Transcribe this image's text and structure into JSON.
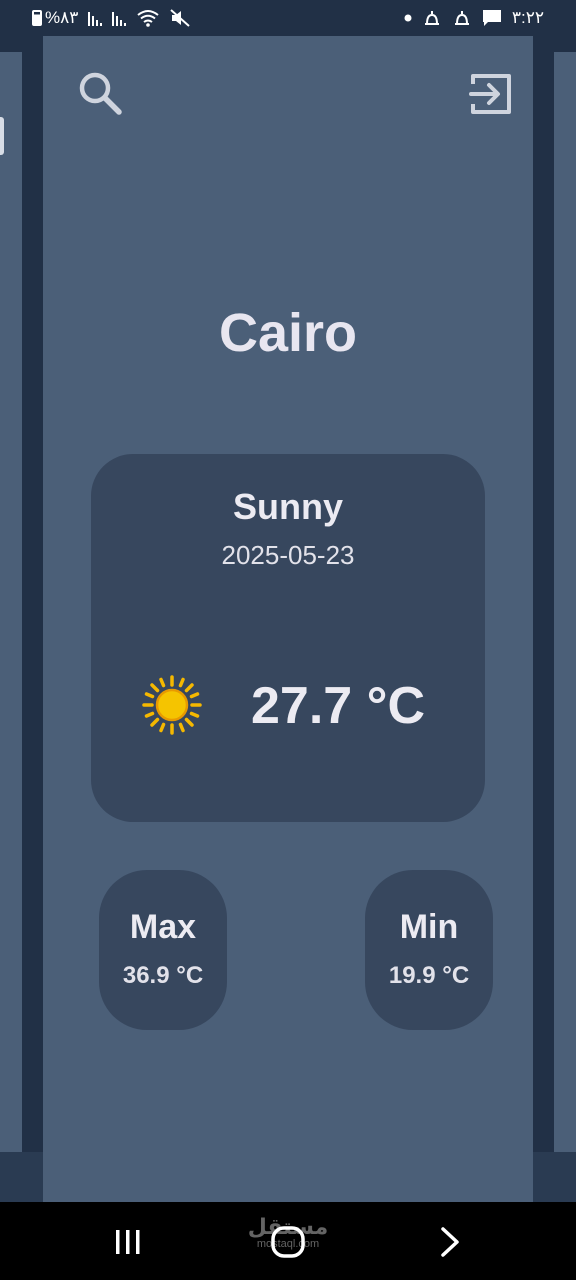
{
  "status_bar": {
    "battery_text": "%٨٣",
    "time": "٣:٢٢",
    "icons_left": [
      "battery-icon",
      "signal-icon",
      "signal-icon",
      "wifi-icon",
      "mute-icon"
    ],
    "icons_right": [
      "dot-icon",
      "notification-icon",
      "notification-icon",
      "message-icon"
    ]
  },
  "header": {
    "search_icon": "search-icon",
    "logout_icon": "logout-icon"
  },
  "main": {
    "city": "Cairo",
    "card": {
      "condition": "Sunny",
      "date": "2025-05-23",
      "weather_icon": "sun-icon",
      "temperature": "27.7 °C"
    },
    "max": {
      "label": "Max",
      "value": "36.9 °C"
    },
    "min": {
      "label": "Min",
      "value": "19.9 °C"
    }
  },
  "nav_bar": {
    "watermark": "مستقل",
    "watermark_sub": "mostaql.com"
  },
  "colors": {
    "background": "#213046",
    "page": "#4b5f78",
    "card": "#37475e",
    "text": "#ecebf2",
    "sun": "#f5c400"
  }
}
